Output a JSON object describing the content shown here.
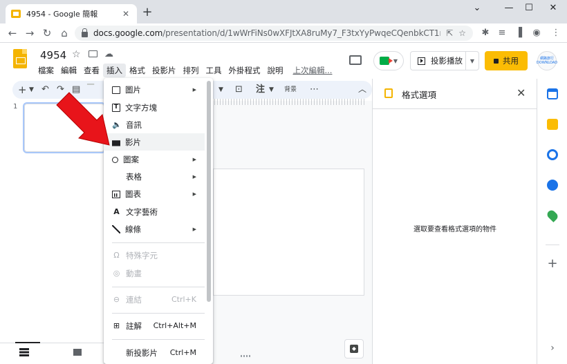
{
  "browser": {
    "tab_title": "4954 - Google 簡報",
    "tab_close": "✕",
    "new_tab": "+",
    "window_controls": [
      "⌄",
      "—",
      "☐",
      "✕"
    ],
    "url_host": "docs.google.com",
    "url_path": "/presentation/d/1wWrFiNs0wXFJtXA8ruMy7_F3txYyPwqeCQenbkCT1nQ/edi...",
    "icons": [
      "back-arrow-icon",
      "forward-arrow-icon",
      "reload-icon",
      "home-icon",
      "lock-icon",
      "share-icon",
      "star-icon",
      "extensions-icon",
      "reading-list-icon",
      "side-panel-icon",
      "profile-icon",
      "more-icon"
    ]
  },
  "app": {
    "doc_title": "4954",
    "menu": [
      "檔案",
      "編輯",
      "查看",
      "插入",
      "格式",
      "投影片",
      "排列",
      "工具",
      "外掛程式",
      "說明"
    ],
    "last_edit": "上次編輯...",
    "present_label": "投影播放",
    "share_label": "共用",
    "avatar_text": "網路旅行 DOWNLOAD"
  },
  "toolbar": {
    "background_label": "背景",
    "note_label": "注"
  },
  "filmstrip": {
    "slide_number": "1"
  },
  "insert_menu": {
    "items": [
      {
        "label": "圖片",
        "icon": "image-icon",
        "submenu": true
      },
      {
        "label": "文字方塊",
        "icon": "textbox-icon",
        "submenu": false
      },
      {
        "label": "音訊",
        "icon": "audio-icon",
        "submenu": false
      },
      {
        "label": "影片",
        "icon": "video-icon",
        "submenu": false,
        "highlighted": true
      },
      {
        "label": "圖案",
        "icon": "shape-icon",
        "submenu": true
      },
      {
        "label": "表格",
        "icon": "",
        "submenu": true
      },
      {
        "label": "圖表",
        "icon": "chart-icon",
        "submenu": true
      },
      {
        "label": "文字藝術",
        "icon": "word-art-icon",
        "submenu": false
      },
      {
        "label": "線條",
        "icon": "line-icon",
        "submenu": true
      },
      {
        "label": "特殊字元",
        "icon": "omega-icon",
        "disabled": true
      },
      {
        "label": "動畫",
        "icon": "animation-icon",
        "disabled": true
      },
      {
        "label": "連結",
        "icon": "link-icon",
        "disabled": true,
        "shortcut": "Ctrl+K"
      },
      {
        "label": "註解",
        "icon": "comment-icon",
        "shortcut": "Ctrl+Alt+M"
      },
      {
        "label": "新投影片",
        "icon": "",
        "shortcut": "Ctrl+M"
      }
    ]
  },
  "format_panel": {
    "title": "格式選項",
    "close": "✕",
    "empty_message": "選取要查看格式選項的物件"
  },
  "side_panel": {
    "icons": [
      "calendar-icon",
      "keep-icon",
      "tasks-icon",
      "contacts-icon",
      "maps-icon"
    ],
    "add": "+",
    "expand": "›"
  },
  "colors": {
    "accent_yellow": "#fbbc04",
    "arrow_red": "#e8141a",
    "toolbar_bg": "#edf2fa"
  }
}
